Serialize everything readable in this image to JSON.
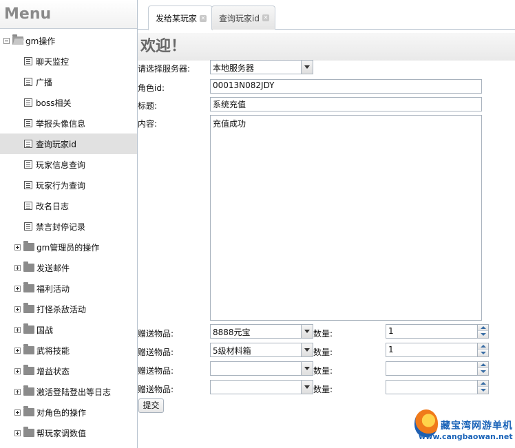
{
  "sidebar": {
    "title": "Menu",
    "root": {
      "label": "gm操作"
    },
    "children": [
      {
        "label": "聊天监控"
      },
      {
        "label": "广播"
      },
      {
        "label": "boss相关"
      },
      {
        "label": "举报头像信息"
      },
      {
        "label": "查询玩家id",
        "selected": true
      },
      {
        "label": "玩家信息查询"
      },
      {
        "label": "玩家行为查询"
      },
      {
        "label": "改名日志"
      },
      {
        "label": "禁言封停记录"
      }
    ],
    "folders": [
      {
        "label": "gm管理员的操作"
      },
      {
        "label": "发送邮件"
      },
      {
        "label": "福利活动"
      },
      {
        "label": "打怪杀敌活动"
      },
      {
        "label": "国战"
      },
      {
        "label": "武将技能"
      },
      {
        "label": "增益状态"
      },
      {
        "label": "激活登陆登出等日志"
      },
      {
        "label": "对角色的操作"
      },
      {
        "label": "帮玩家调数值"
      }
    ]
  },
  "tabs": [
    {
      "label": "发给某玩家",
      "active": true
    },
    {
      "label": "查询玩家id",
      "active": false
    }
  ],
  "main": {
    "welcome": "欢迎！",
    "server_label": "请选择服务器:",
    "server_value": "本地服务器",
    "role_label": "角色id:",
    "role_value": "00013N082JDY",
    "title_label": "标题:",
    "title_value": "系统充值",
    "content_label": "内容:",
    "content_value": "充值成功",
    "gifts": [
      {
        "label": "赠送物品:",
        "item": "8888元宝",
        "qty_label": "数量:",
        "qty": "1"
      },
      {
        "label": "赠送物品:",
        "item": "5级材料箱",
        "qty_label": "数量:",
        "qty": "1"
      },
      {
        "label": "赠送物品:",
        "item": "",
        "qty_label": "数量:",
        "qty": ""
      },
      {
        "label": "赠送物品:",
        "item": "",
        "qty_label": "数量:",
        "qty": ""
      }
    ],
    "submit_label": "提交"
  },
  "watermark": {
    "name": "藏宝湾网游单机",
    "url": "www.cangbaowan.net"
  }
}
